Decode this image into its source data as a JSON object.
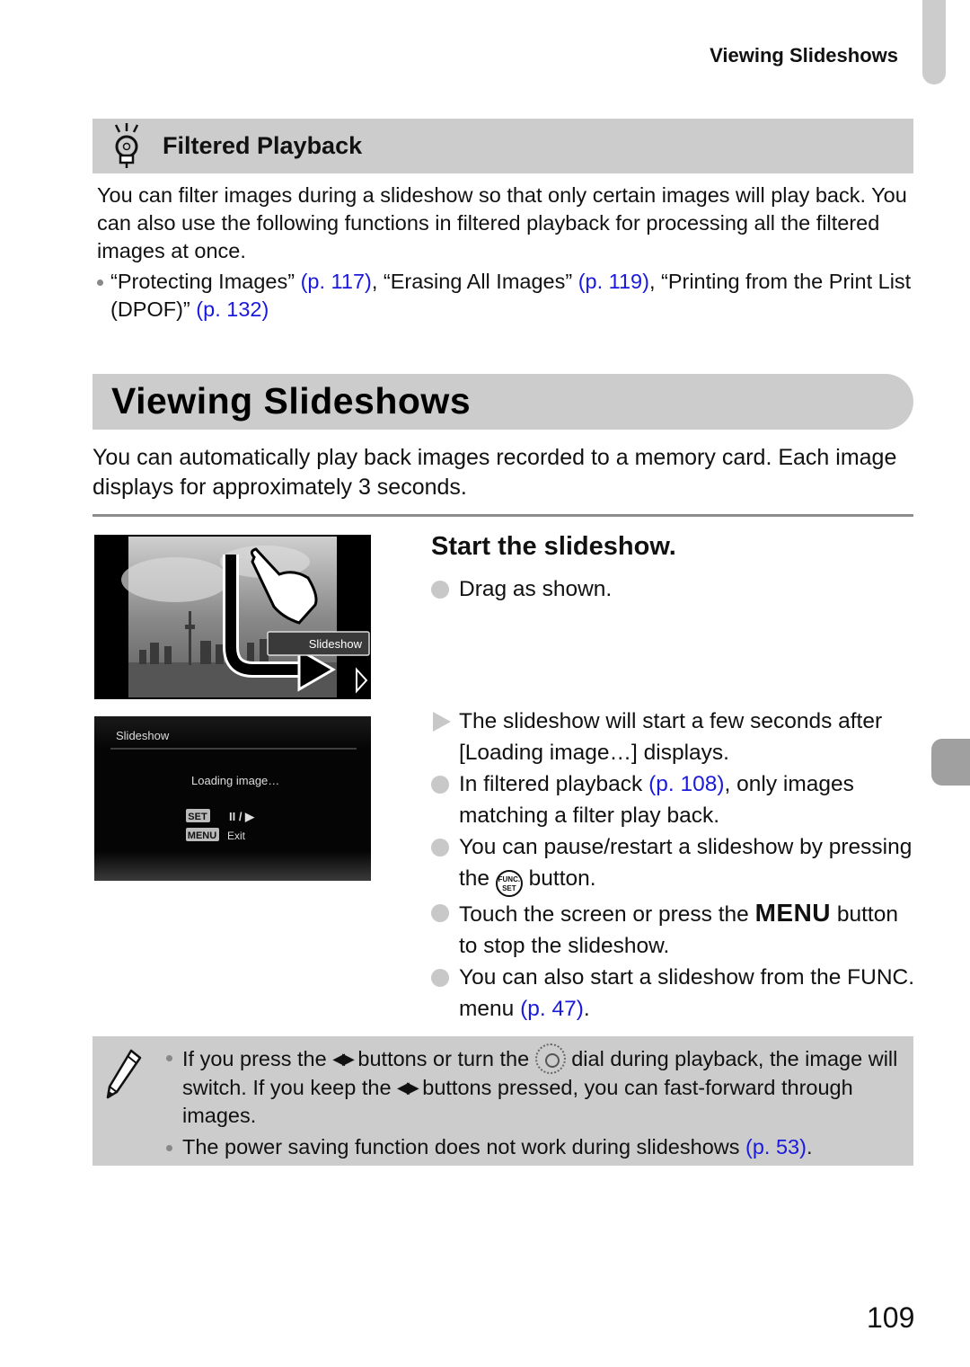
{
  "header": {
    "running_title": "Viewing Slideshows"
  },
  "tip": {
    "title": "Filtered Playback",
    "icon": "lightbulb-icon",
    "body": "You can filter images during a slideshow so that only certain images will play back. You can also use the following functions in filtered playback for processing all the filtered images at once.",
    "bullet": {
      "part1": "“Protecting Images” ",
      "link1": "(p. 117)",
      "part2": ", “Erasing All Images” ",
      "link2": "(p. 119)",
      "part3": ", “Printing from the Print List (DPOF)” ",
      "link3": "(p. 132)"
    }
  },
  "section": {
    "title": "Viewing Slideshows",
    "intro": "You can automatically play back images recorded to a memory card. Each image displays for approximately 3 seconds."
  },
  "screens": {
    "screen1": {
      "button_label": "Slideshow"
    },
    "screen2": {
      "title": "Slideshow",
      "loading": "Loading image…",
      "set_key": "SET",
      "pause_play": "II / ▶",
      "menu_key": "MENU",
      "exit": "Exit"
    }
  },
  "step": {
    "title": "Start the slideshow.",
    "items": [
      {
        "type": "circle",
        "text": "Drag as shown."
      },
      {
        "type": "triangle",
        "text": "The slideshow will start a few seconds after [Loading image…] displays."
      },
      {
        "type": "circle",
        "pre": "In filtered playback ",
        "link": "(p. 108)",
        "post": ", only images matching a filter play back."
      },
      {
        "type": "circle",
        "pre": "You can pause/restart a slideshow by pressing the ",
        "icon_top": "FUNC.",
        "icon_bottom": "SET",
        "post": " button."
      },
      {
        "type": "circle",
        "pre": "Touch the screen or press the ",
        "menu": "MENU",
        "post": " button to stop the slideshow."
      },
      {
        "type": "circle",
        "pre": "You can also start a slideshow from the FUNC. menu ",
        "link": "(p. 47)",
        "post": "."
      }
    ]
  },
  "note": {
    "icon": "pencil-icon",
    "items": [
      {
        "p1": "If you press the ",
        "arrows": "◀▶",
        "p2": " buttons or turn the ",
        "p3": " dial during playback, the image will switch. If you keep the ",
        "arrows2": "◀▶",
        "p4": " buttons pressed, you can fast-forward through images."
      },
      {
        "p1": "The power saving function does not work during slideshows ",
        "link": "(p. 53)",
        "p2": "."
      }
    ]
  },
  "page_number": "109",
  "colors": {
    "link": "#1a1adc",
    "bar_gray": "#cccccc",
    "tab_gray": "#a0a0a0"
  }
}
